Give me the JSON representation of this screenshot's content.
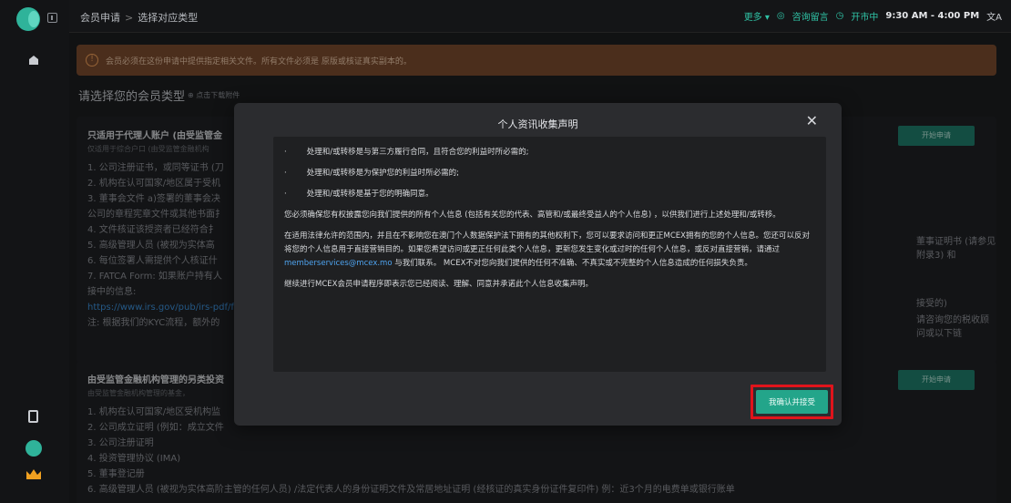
{
  "sidebar": {
    "icons": [
      "logo-icon",
      "collapse-icon",
      "home-icon",
      "document-icon",
      "user-icon",
      "crown-icon"
    ]
  },
  "topbar": {
    "breadcrumb": [
      "会员申请",
      "选择对应类型"
    ],
    "more": "更多 ▾",
    "consult": "咨询留言",
    "status": "开市中",
    "hours": "9:30 AM - 4:00 PM",
    "lang_icon": "文A"
  },
  "notice": {
    "text": "会员必须在这份申请中提供指定相关文件。所有文件必须是 原版或核证真实副本的。"
  },
  "section": {
    "title": "请选择您的会员类型",
    "download": "点击下载附件"
  },
  "card1": {
    "title": "只适用于代理人账户 (由受监管金",
    "subtitle": "仅适用于综合户口 (由受监管金融机构",
    "apply": "开始申请",
    "lines": [
      "1. 公司注册证书，或同等证书 (刀",
      "2. 机构在认可国家/地区属于受机",
      "3. 董事会文件 a)签署的董事会决",
      "公司的章程宪章文件或其他书面扌",
      "4. 文件核证该授资者已经符合扌",
      "5. 高级管理人员 (被视为实体高",
      "6. 每位签署人需提供个人核证什",
      "7. FATCA Form: 如果账户持有人",
      "接中的信息:"
    ],
    "link": "https://www.irs.gov/pub/irs-pdf/fv",
    "note": "注: 根据我们的KYC流程，额外的",
    "right_frag1": "董事证明书 (请参见附录3) 和",
    "right_frag2": "接受的)",
    "right_frag3": "请咨询您的税收顾问或以下链"
  },
  "card2": {
    "title": "由受监管金融机构管理的另类投资",
    "subtitle": "由受监管金融机构管理的基金，",
    "apply": "开始申请",
    "lines": [
      "1. 机构在认可国家/地区受机构监",
      "2. 公司成立证明 (例如：成立文件",
      "3. 公司注册证明",
      "4. 投资管理协议 (IMA)",
      "5. 董事登记册",
      "6. 高级管理人员 (被视为实体高阶主管的任何人员) /法定代表人的身份证明文件及常居地址证明 (经核证的真实身份证件复印件) 例：近3个月的电费单或银行账单"
    ]
  },
  "modal": {
    "title": "个人资讯收集声明",
    "close": "✕",
    "bullets": [
      "处理和/或转移是与第三方履行合同，且符合您的利益时所必需的;",
      "处理和/或转移是为保护您的利益时所必需的;",
      "处理和/或转移是基于您的明确同意。"
    ],
    "para1": "您必须确保您有权披露您向我们提供的所有个人信息 (包括有关您的代表、高管和/或最终受益人的个人信息) ，以供我们进行上述处理和/或转移。",
    "para2_a": "在适用法律允许的范围内，并且在不影响您在澳门个人数据保护法下拥有的其他权利下，您可以要求访问和更正MCEX拥有的您的个人信息。您还可以反对将您的个人信息用于直接营销目的。如果您希望访问或更正任何此类个人信息，更新您发生变化或过时的任何个人信息，或反对直接营销，请通过",
    "para2_link": "memberservices@mcex.mo",
    "para2_b": "与我们联系。 MCEX不对您向我们提供的任何不准确、不真实或不完整的个人信息造成的任何损失负责。",
    "para3": "继续进行MCEX会员申请程序即表示您已经阅读、理解、同意并承诺此个人信息收集声明。",
    "accept": "我确认并接受"
  }
}
